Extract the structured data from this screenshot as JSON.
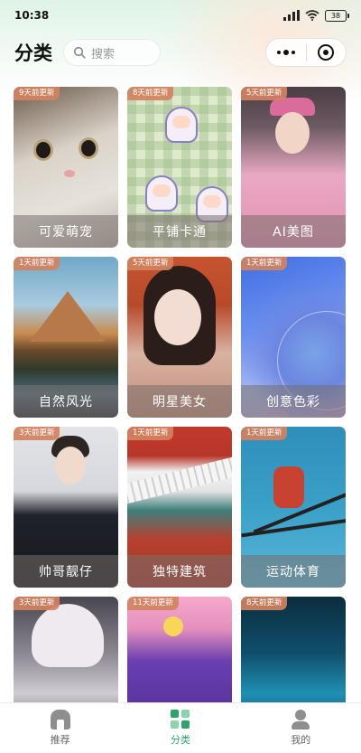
{
  "status_bar": {
    "time": "10:38",
    "battery": "38"
  },
  "header": {
    "title": "分类",
    "search_placeholder": "搜索"
  },
  "categories": [
    {
      "label": "可爱萌宠",
      "badge": "9天前更新"
    },
    {
      "label": "平铺卡通",
      "badge": "8天前更新"
    },
    {
      "label": "AI美图",
      "badge": "5天前更新"
    },
    {
      "label": "自然风光",
      "badge": "1天前更新"
    },
    {
      "label": "明星美女",
      "badge": "5天前更新"
    },
    {
      "label": "创意色彩",
      "badge": "1天前更新"
    },
    {
      "label": "帅哥靓仔",
      "badge": "3天前更新"
    },
    {
      "label": "独特建筑",
      "badge": "1天前更新"
    },
    {
      "label": "运动体育",
      "badge": "1天前更新"
    },
    {
      "label": "",
      "badge": "3天前更新"
    },
    {
      "label": "",
      "badge": "11天前更新"
    },
    {
      "label": "",
      "badge": "8天前更新"
    }
  ],
  "tabbar": [
    {
      "label": "推荐",
      "icon": "home-icon",
      "active": false
    },
    {
      "label": "分类",
      "icon": "grid-icon",
      "active": true
    },
    {
      "label": "我的",
      "icon": "user-icon",
      "active": false
    }
  ],
  "colors": {
    "accent": "#2fa36a",
    "badge": "#d2825f"
  }
}
